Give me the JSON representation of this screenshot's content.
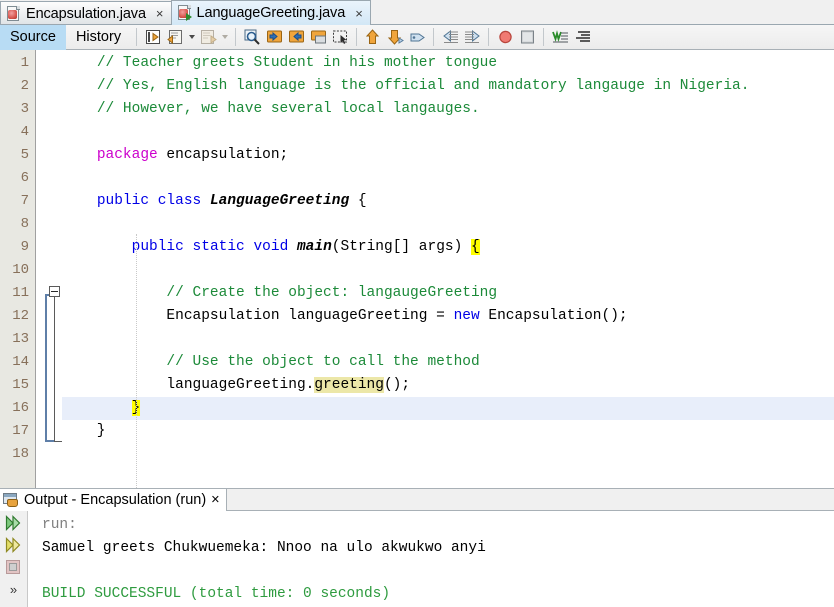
{
  "window": {
    "accent": "#b8dcf4",
    "border_color": "#9aa7b0"
  },
  "editor_tabs": [
    {
      "label": "Encapsulation.java",
      "icon": "java-file-icon",
      "close": "×",
      "active": false
    },
    {
      "label": "LanguageGreeting.java",
      "icon": "java-main-file-icon",
      "close": "×",
      "active": true
    }
  ],
  "view_tabs": [
    {
      "label": "Source",
      "selected": true
    },
    {
      "label": "History",
      "selected": false
    }
  ],
  "toolbar": {
    "buttons": [
      {
        "name": "last-edit-position-icon",
        "glyph": "last-edit"
      },
      {
        "name": "back-history-icon",
        "glyph": "back-doc",
        "dropdown": true
      },
      {
        "name": "forward-history-icon",
        "glyph": "fwd-doc",
        "dropdown": true,
        "disabled": true
      },
      {
        "name": "find-selection-icon",
        "glyph": "magnifier"
      },
      {
        "name": "find-previous-icon",
        "glyph": "arrow-left-box"
      },
      {
        "name": "find-next-icon",
        "glyph": "arrow-right-box"
      },
      {
        "name": "toggle-highlight-icon",
        "glyph": "highlight-box"
      },
      {
        "name": "toggle-rectangular-selection-icon",
        "glyph": "dotted-select"
      },
      {
        "name": "previous-bookmark-icon",
        "glyph": "arrow-up-tag"
      },
      {
        "name": "next-bookmark-icon",
        "glyph": "arrow-down-tag"
      },
      {
        "name": "toggle-bookmark-icon",
        "glyph": "tag"
      },
      {
        "name": "shift-line-left-icon",
        "glyph": "shift-left"
      },
      {
        "name": "shift-line-right-icon",
        "glyph": "shift-right"
      },
      {
        "name": "toggle-breakpoint-icon",
        "glyph": "red-circle"
      },
      {
        "name": "stop-icon",
        "glyph": "grey-square"
      },
      {
        "name": "format-icon",
        "glyph": "format-green"
      },
      {
        "name": "toggle-comment-icon",
        "glyph": "lines-black"
      }
    ]
  },
  "code": {
    "lines": [
      {
        "n": "1",
        "current": false,
        "segments": [
          {
            "t": "    ",
            "c": ""
          },
          {
            "t": "// Teacher greets Student in his mother tongue",
            "c": "cmt"
          }
        ]
      },
      {
        "n": "2",
        "current": false,
        "segments": [
          {
            "t": "    ",
            "c": ""
          },
          {
            "t": "// Yes, English language is the official and mandatory langauge in Nigeria.",
            "c": "cmt"
          }
        ]
      },
      {
        "n": "3",
        "current": false,
        "segments": [
          {
            "t": "    ",
            "c": ""
          },
          {
            "t": "// However, we have several local langauges.",
            "c": "cmt"
          }
        ]
      },
      {
        "n": "4",
        "current": false,
        "segments": []
      },
      {
        "n": "5",
        "current": false,
        "segments": [
          {
            "t": "    ",
            "c": ""
          },
          {
            "t": "package",
            "c": "kwp"
          },
          {
            "t": " encapsulation;",
            "c": ""
          }
        ]
      },
      {
        "n": "6",
        "current": false,
        "segments": []
      },
      {
        "n": "7",
        "current": false,
        "segments": [
          {
            "t": "    ",
            "c": ""
          },
          {
            "t": "public",
            "c": "kw"
          },
          {
            "t": " ",
            "c": ""
          },
          {
            "t": "class",
            "c": "kw"
          },
          {
            "t": " ",
            "c": ""
          },
          {
            "t": "LanguageGreeting",
            "c": "mn"
          },
          {
            "t": " {",
            "c": ""
          }
        ]
      },
      {
        "n": "8",
        "current": false,
        "segments": []
      },
      {
        "n": "9",
        "current": false,
        "segments": [
          {
            "t": "        ",
            "c": ""
          },
          {
            "t": "public",
            "c": "kw"
          },
          {
            "t": " ",
            "c": ""
          },
          {
            "t": "static",
            "c": "kw"
          },
          {
            "t": " ",
            "c": ""
          },
          {
            "t": "void",
            "c": "kw"
          },
          {
            "t": " ",
            "c": ""
          },
          {
            "t": "main",
            "c": "mn"
          },
          {
            "t": "(String[] args) ",
            "c": ""
          },
          {
            "t": "{",
            "c": "hl"
          }
        ]
      },
      {
        "n": "10",
        "current": false,
        "segments": []
      },
      {
        "n": "11",
        "current": false,
        "segments": [
          {
            "t": "            ",
            "c": ""
          },
          {
            "t": "// Create the object: langaugeGreeting",
            "c": "cmt"
          }
        ]
      },
      {
        "n": "12",
        "current": false,
        "segments": [
          {
            "t": "            Encapsulation languageGreeting = ",
            "c": ""
          },
          {
            "t": "new",
            "c": "kw"
          },
          {
            "t": " Encapsulation();",
            "c": ""
          }
        ]
      },
      {
        "n": "13",
        "current": false,
        "segments": []
      },
      {
        "n": "14",
        "current": false,
        "segments": [
          {
            "t": "            ",
            "c": ""
          },
          {
            "t": "// Use the object to call the method",
            "c": "cmt"
          }
        ]
      },
      {
        "n": "15",
        "current": false,
        "segments": [
          {
            "t": "            languageGreeting.",
            "c": ""
          },
          {
            "t": "greeting",
            "c": "hlm"
          },
          {
            "t": "();",
            "c": ""
          }
        ]
      },
      {
        "n": "16",
        "current": true,
        "segments": [
          {
            "t": "        ",
            "c": ""
          },
          {
            "t": "}",
            "c": "hl"
          }
        ]
      },
      {
        "n": "17",
        "current": false,
        "segments": [
          {
            "t": "    }",
            "c": ""
          }
        ]
      },
      {
        "n": "18",
        "current": false,
        "segments": []
      }
    ]
  },
  "output_panel": {
    "tab_label": "Output - Encapsulation (run)",
    "tab_close": "×",
    "tab_icon": "output-window-icon",
    "gutter_buttons": [
      {
        "name": "rerun-icon",
        "glyph": "green-double-arrow"
      },
      {
        "name": "rerun-with-different-params-icon",
        "glyph": "yellow-double-arrow"
      },
      {
        "name": "stop-process-icon",
        "glyph": "stop-square"
      },
      {
        "name": "expand-toolbar-icon",
        "glyph": "chevrons"
      }
    ],
    "lines": [
      {
        "text": "run:",
        "style": "o-dim"
      },
      {
        "text": "Samuel greets Chukwuemeka: Nnoo na ulo akwukwo anyi",
        "style": ""
      },
      {
        "text": "",
        "style": ""
      },
      {
        "text": "BUILD SUCCESSFUL (total time: 0 seconds)",
        "style": "o-ok"
      }
    ]
  }
}
